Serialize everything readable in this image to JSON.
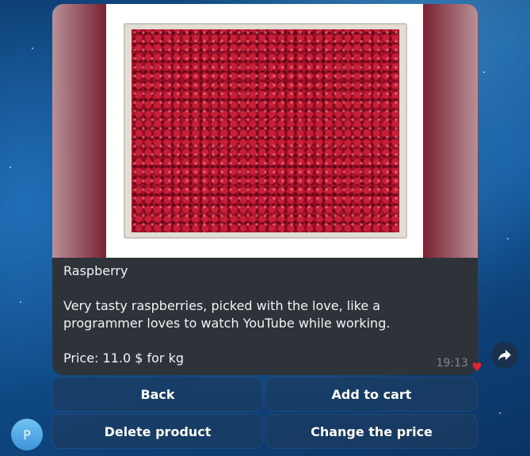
{
  "message": {
    "photo_alt": "Raspberry product photo",
    "title": "Raspberry",
    "description": "Very tasty raspberries, picked with the love, like a programmer loves to watch YouTube while working.",
    "price": "Price: 11.0 $ for kg",
    "time": "19:13",
    "reaction_icon": "heart-icon",
    "reaction_color": "#e8222f"
  },
  "keyboard": {
    "back": "Back",
    "add_to_cart": "Add to cart",
    "delete_product": "Delete product",
    "change_price": "Change the price"
  },
  "sender": {
    "avatar_initial": "P",
    "avatar_color": "#4fa6e6"
  },
  "share_icon": "share-arrow-icon"
}
